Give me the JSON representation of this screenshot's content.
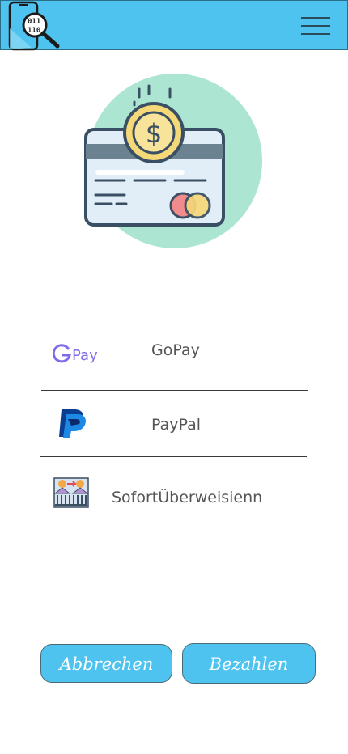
{
  "header": {
    "logo_icon": "phone-binary-search-icon",
    "menu_icon": "hamburger-menu-icon",
    "bar_color": "#4fc3ef"
  },
  "hero": {
    "icon": "credit-card-dollar-coin-icon"
  },
  "payment_methods": [
    {
      "icon": "google-pay-logo-icon",
      "logo_text": "Pay",
      "label": "GoPay"
    },
    {
      "icon": "paypal-logo-icon",
      "label": "PayPal"
    },
    {
      "icon": "bank-transfer-icon",
      "label": "SofortÜberweisienn"
    }
  ],
  "actions": {
    "cancel_label": "Abbrechen",
    "pay_label": "Bezahlen",
    "button_color": "#4fc3ef"
  }
}
